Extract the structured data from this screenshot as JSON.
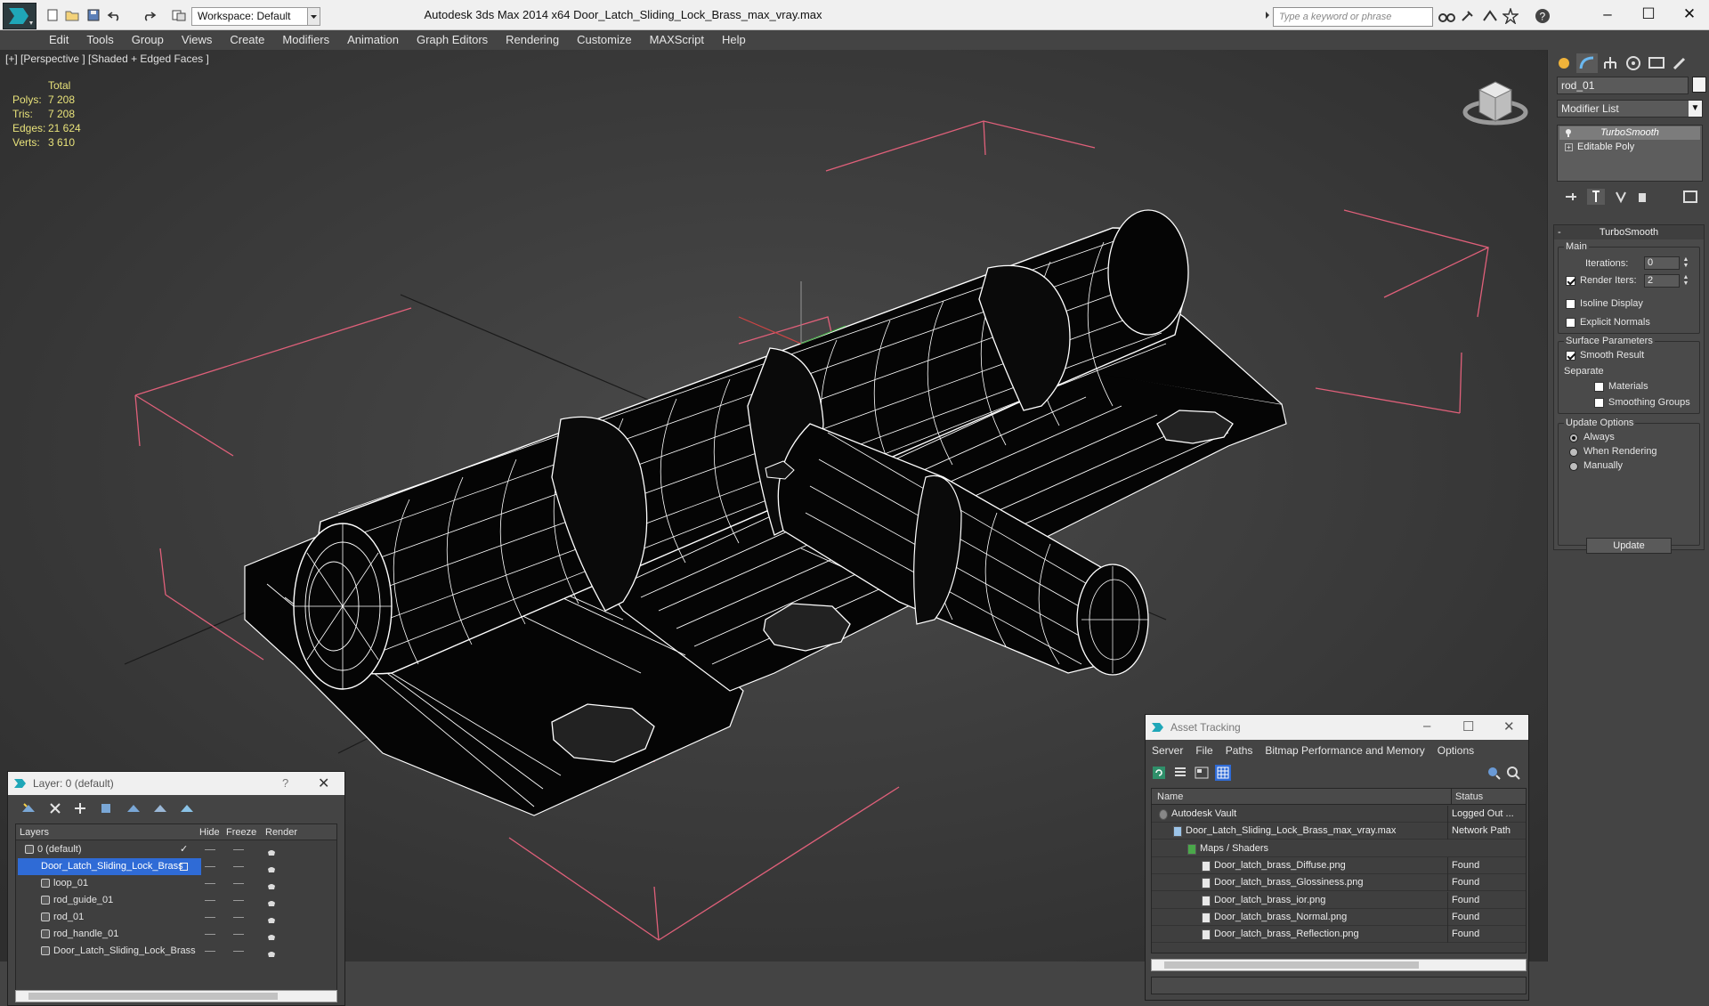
{
  "app": {
    "title": "Autodesk 3ds Max  2014 x64     Door_Latch_Sliding_Lock_Brass_max_vray.max",
    "workspace": "Workspace: Default",
    "search_placeholder": "Type a keyword or phrase",
    "window_controls": [
      "–",
      "☐",
      "✕"
    ]
  },
  "menu": [
    "Edit",
    "Tools",
    "Group",
    "Views",
    "Create",
    "Modifiers",
    "Animation",
    "Graph Editors",
    "Rendering",
    "Customize",
    "MAXScript",
    "Help"
  ],
  "viewport": {
    "label": "[+] [Perspective ] [Shaded + Edged Faces ]",
    "stats": {
      "total_label": "Total",
      "rows": [
        {
          "label": "Polys:",
          "value": "7 208"
        },
        {
          "label": "Tris:",
          "value": "7 208"
        },
        {
          "label": "Edges:",
          "value": "21 624"
        },
        {
          "label": "Verts:",
          "value": "3 610"
        }
      ]
    }
  },
  "command_panel": {
    "object_name": "rod_01",
    "modifier_list": "Modifier List",
    "stack": [
      "TurboSmooth",
      "Editable Poly"
    ],
    "rollout": {
      "title": "TurboSmooth",
      "main_label": "Main",
      "iterations_label": "Iterations:",
      "iterations_value": "0",
      "render_iters_label": "Render Iters:",
      "render_iters_value": "2",
      "render_iters_checked": true,
      "isoline_label": "Isoline Display",
      "isoline_checked": false,
      "explicit_normals_label": "Explicit Normals",
      "explicit_normals_checked": false,
      "surface_label": "Surface Parameters",
      "smooth_result_label": "Smooth Result",
      "smooth_result_checked": true,
      "separate_label": "Separate",
      "materials_label": "Materials",
      "materials_checked": false,
      "smoothing_groups_label": "Smoothing Groups",
      "smoothing_groups_checked": false,
      "update_options_label": "Update Options",
      "always_label": "Always",
      "when_rendering_label": "When Rendering",
      "manually_label": "Manually",
      "update_selected": "Always",
      "update_button": "Update"
    }
  },
  "layer_manager": {
    "title": "Layer: 0 (default)",
    "help": "?",
    "close": "✕",
    "columns": [
      "Layers",
      "Hide",
      "Freeze",
      "Render"
    ],
    "rows": [
      {
        "name": "0 (default)",
        "level": 0,
        "active": true
      },
      {
        "name": "Door_Latch_Sliding_Lock_Brass",
        "level": 0,
        "selected": true
      },
      {
        "name": "loop_01",
        "level": 1
      },
      {
        "name": "rod_guide_01",
        "level": 1
      },
      {
        "name": "rod_01",
        "level": 1
      },
      {
        "name": "rod_handle_01",
        "level": 1
      },
      {
        "name": "Door_Latch_Sliding_Lock_Brass",
        "level": 1
      }
    ]
  },
  "asset_tracking": {
    "title": "Asset Tracking",
    "controls": [
      "–",
      "☐",
      "✕"
    ],
    "menu": [
      "Server",
      "File",
      "Paths",
      "Bitmap Performance and Memory",
      "Options"
    ],
    "columns": [
      "Name",
      "Status"
    ],
    "rows": [
      {
        "name": "Autodesk Vault",
        "status": "Logged Out ...",
        "level": 0
      },
      {
        "name": "Door_Latch_Sliding_Lock_Brass_max_vray.max",
        "status": "Network Path",
        "level": 1
      },
      {
        "name": "Maps / Shaders",
        "status": "",
        "level": 2
      },
      {
        "name": "Door_latch_brass_Diffuse.png",
        "status": "Found",
        "level": 3
      },
      {
        "name": "Door_latch_brass_Glossiness.png",
        "status": "Found",
        "level": 3
      },
      {
        "name": "Door_latch_brass_ior.png",
        "status": "Found",
        "level": 3
      },
      {
        "name": "Door_latch_brass_Normal.png",
        "status": "Found",
        "level": 3
      },
      {
        "name": "Door_latch_brass_Reflection.png",
        "status": "Found",
        "level": 3
      }
    ]
  },
  "colors": {
    "stats_text": "#e8e27a",
    "selection": "#2f6bd6",
    "bounding_box": "#e0607a",
    "wire": "#ffffff"
  }
}
